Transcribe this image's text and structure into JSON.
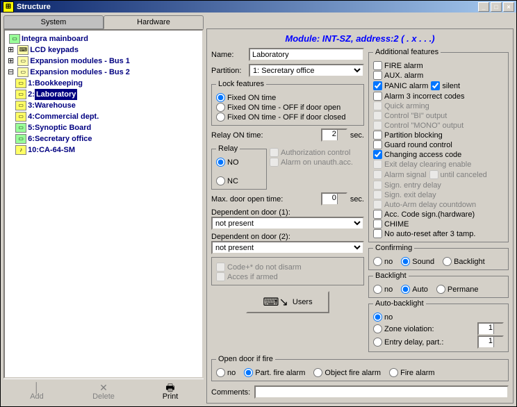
{
  "title": "Structure",
  "tabs": {
    "system": "System",
    "hardware": "Hardware"
  },
  "tree": {
    "root": "Integra mainboard",
    "n1": "LCD keypads",
    "n2": "Expansion modules - Bus 1",
    "n3": "Expansion modules - Bus 2",
    "items": [
      {
        "num": "1:",
        "label": "Bookkeeping"
      },
      {
        "num": "2:",
        "label": "Laboratory"
      },
      {
        "num": "3:",
        "label": "Warehouse"
      },
      {
        "num": "4:",
        "label": "Commercial dept."
      },
      {
        "num": "5:",
        "label": "Synoptic Board"
      },
      {
        "num": "6:",
        "label": "Secretary office"
      },
      {
        "num": "10:",
        "label": "CA-64-SM"
      }
    ]
  },
  "bottom": {
    "add": "Add",
    "delete": "Delete",
    "print": "Print"
  },
  "module_title": "Module: INT-SZ, address:2 ( . x . . .)",
  "form": {
    "name_lbl": "Name:",
    "name_val": "Laboratory",
    "part_lbl": "Partition:",
    "part_val": "1: Secretary office",
    "lock_legend": "Lock features",
    "lock1": "Fixed ON time",
    "lock2": "Fixed ON time - OFF if door open",
    "lock3": "Fixed ON time - OFF if door closed",
    "relay_time_lbl": "Relay ON time:",
    "relay_time_val": "2",
    "sec": "sec.",
    "relay_legend": "Relay",
    "relay_no": "NO",
    "relay_nc": "NC",
    "auth": "Authorization control",
    "alarm_unauth": "Alarm on unauth.acc.",
    "max_door_lbl": "Max. door open time:",
    "max_door_val": "0",
    "dep1_lbl": "Dependent on door (1):",
    "dep2_lbl": "Dependent on door (2):",
    "not_present": "not present",
    "codeplus": "Code+* do not disarm",
    "access_armed": "Acces if armed",
    "users": "Users",
    "open_legend": "Open door if fire",
    "of_no": "no",
    "of_part": "Part. fire alarm",
    "of_obj": "Object fire alarm",
    "of_fire": "Fire alarm",
    "comments_lbl": "Comments:"
  },
  "feat": {
    "legend": "Additional features",
    "fire": "FIRE alarm",
    "aux": "AUX. alarm",
    "panic": "PANIC alarm",
    "silent": "silent",
    "a3": "Alarm 3 incorrect codes",
    "quick": "Quick arming",
    "cbi": "Control \"BI\" output",
    "cmono": "Control \"MONO\" output",
    "pblock": "Partition blocking",
    "guard": "Guard round control",
    "chg": "Changing access code",
    "exit": "Exit delay clearing enable",
    "asig": "Alarm signal",
    "until": "until canceled",
    "sentry": "Sign. entry delay",
    "sexit": "Sign. exit delay",
    "autoarm": "Auto-Arm delay countdown",
    "acc": "Acc. Code sign.(hardware)",
    "chime": "CHIME",
    "noauto": "No auto-reset after 3 tamp.",
    "conf_legend": "Confirming",
    "cno": "no",
    "csound": "Sound",
    "cback": "Backlight",
    "bl_legend": "Backlight",
    "bno": "no",
    "bauto": "Auto",
    "bperm": "Permane",
    "abl_legend": "Auto-backlight",
    "ano": "no",
    "azone": "Zone violation:",
    "aentry": "Entry delay, part.:",
    "av1": "1",
    "av2": "1"
  }
}
